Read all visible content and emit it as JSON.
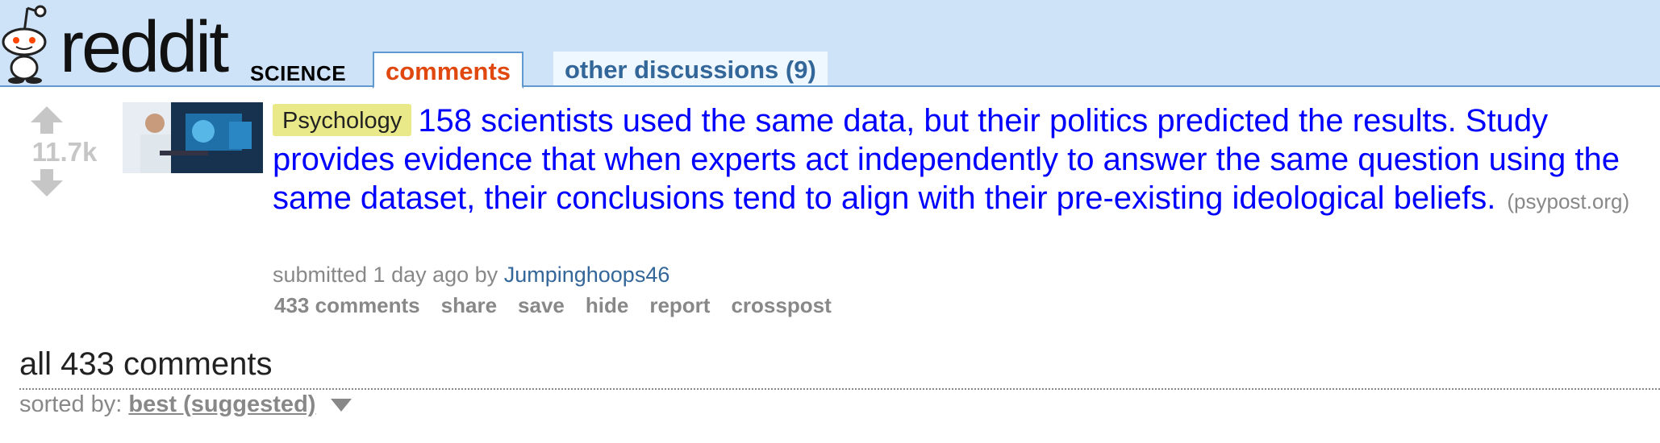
{
  "header": {
    "logo_text": "reddit",
    "subreddit": "SCIENCE",
    "tabs": [
      {
        "label": "comments",
        "active": true
      },
      {
        "label": "other discussions (9)",
        "active": false
      }
    ]
  },
  "post": {
    "score": "11.7k",
    "flair": "Psychology",
    "title": "158 scientists used the same data, but their politics predicted the results. Study provides evidence that when experts act independently to answer the same question using the same dataset, their conclusions tend to align with their pre-existing ideological beliefs.",
    "domain": "(psypost.org)",
    "tagline_prefix": "submitted 1 day ago by",
    "author": "Jumpinghoops46",
    "buttons": [
      "433 comments",
      "share",
      "save",
      "hide",
      "report",
      "crosspost"
    ]
  },
  "comments_section": {
    "title": "all 433 comments",
    "sort_label": "sorted by:",
    "sort_value": "best (suggested)"
  },
  "colors": {
    "header_bg": "#cee3f8",
    "link_blue": "#0000ff",
    "active_tab": "#e0480f",
    "flair_bg": "#e9e98a"
  }
}
